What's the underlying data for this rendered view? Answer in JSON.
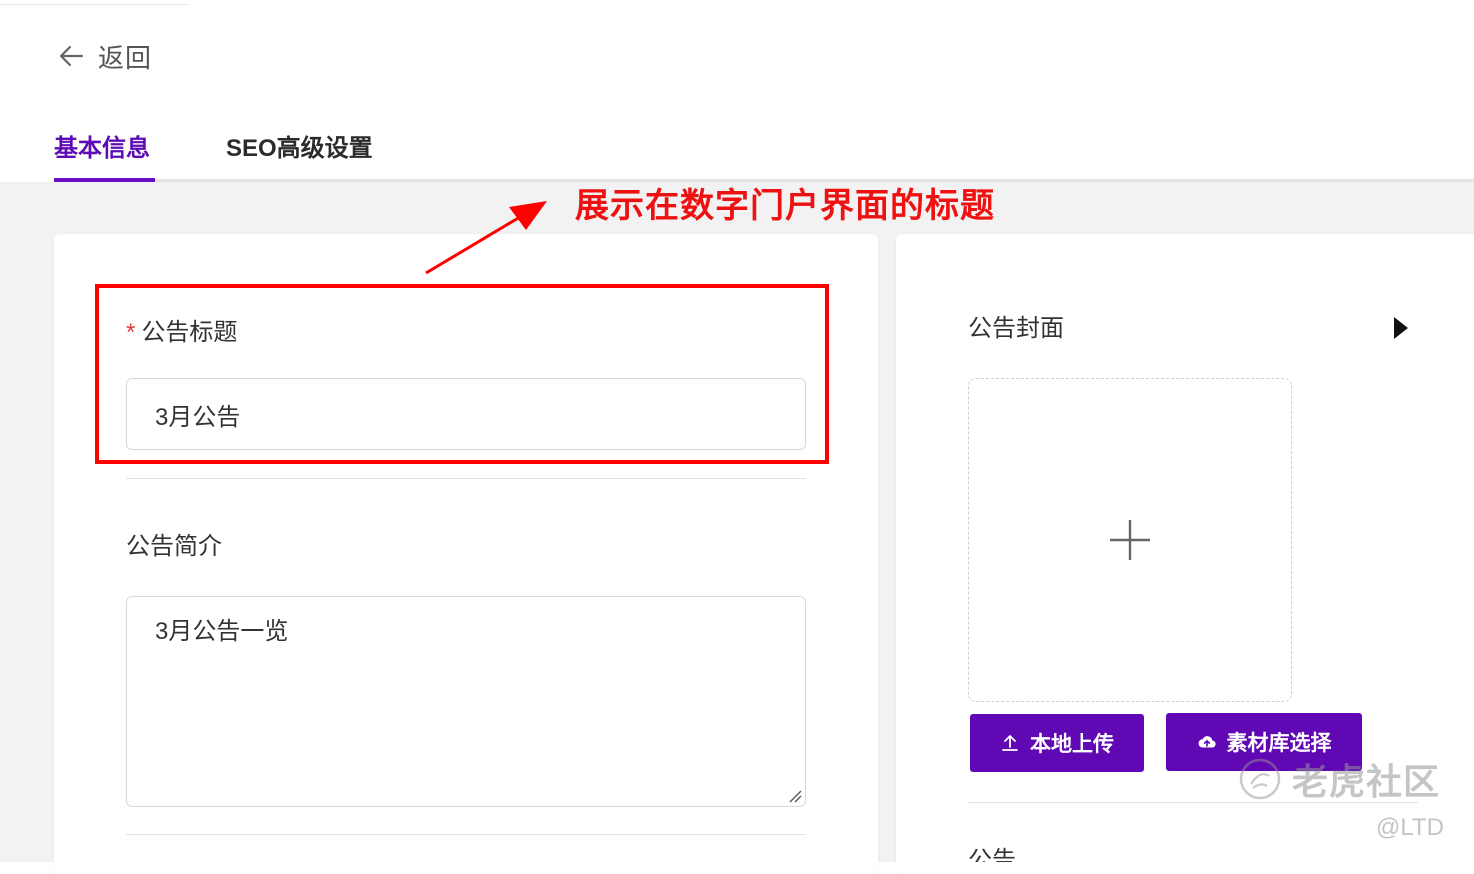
{
  "header": {
    "back_label": "返回"
  },
  "tabs": [
    {
      "label": "基本信息",
      "active": true
    },
    {
      "label": "SEO高级设置",
      "active": false
    }
  ],
  "form": {
    "title_label": "公告标题",
    "required_mark": "*",
    "title_value": "3月公告",
    "summary_label": "公告简介",
    "summary_value": "3月公告一览"
  },
  "cover": {
    "label": "公告封面",
    "upload_local_label": "本地上传",
    "library_select_label": "素材库选择",
    "next_field_label_partial": "公告"
  },
  "annotation": {
    "text": "展示在数字门户界面的标题",
    "color": "#ff0000"
  },
  "watermark": {
    "main": "老虎社区",
    "sub": "@LTD"
  },
  "colors": {
    "accent": "#5f08b4",
    "tab_active": "#5c0bb5",
    "required": "#e23b3b"
  },
  "icons": [
    "arrow-left-icon",
    "plus-icon",
    "upload-icon",
    "cloud-upload-icon",
    "caret-right-icon",
    "resize-grip-icon"
  ]
}
